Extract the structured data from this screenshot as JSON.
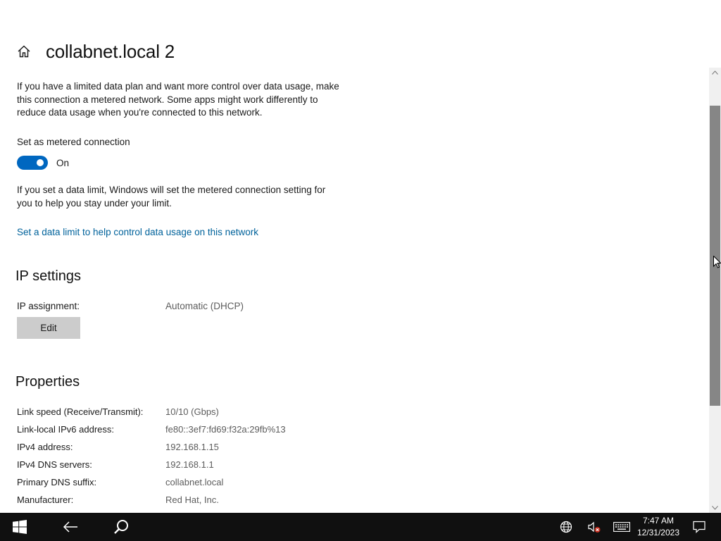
{
  "page": {
    "title": "collabnet.local 2",
    "metered_description": "If you have a limited data plan and want more control over data usage, make this connection a metered network. Some apps might work differently to reduce data usage when you're connected to this network.",
    "metered_label": "Set as metered connection",
    "metered_toggle_state": "On",
    "metered_toggle_on": true,
    "data_limit_note": "If you set a data limit, Windows will set the metered connection setting for you to help you stay under your limit.",
    "data_limit_link": "Set a data limit to help control data usage on this network"
  },
  "ip_settings": {
    "heading": "IP settings",
    "assignment_label": "IP assignment:",
    "assignment_value": "Automatic (DHCP)",
    "edit_label": "Edit"
  },
  "properties": {
    "heading": "Properties",
    "rows": [
      {
        "key": "Link speed (Receive/Transmit):",
        "value": "10/10 (Gbps)"
      },
      {
        "key": "Link-local IPv6 address:",
        "value": "fe80::3ef7:fd69:f32a:29fb%13"
      },
      {
        "key": "IPv4 address:",
        "value": "192.168.1.15"
      },
      {
        "key": "IPv4 DNS servers:",
        "value": "192.168.1.1"
      },
      {
        "key": "Primary DNS suffix:",
        "value": "collabnet.local"
      },
      {
        "key": "Manufacturer:",
        "value": "Red Hat, Inc."
      }
    ]
  },
  "taskbar": {
    "time": "7:47 AM",
    "date": "12/31/2023",
    "icons": [
      "windows-start-icon",
      "back-arrow-icon",
      "search-icon",
      "network-globe-icon",
      "volume-muted-icon",
      "keyboard-icon",
      "notification-icon"
    ]
  },
  "colors": {
    "accent": "#0067c0",
    "link": "#00629b",
    "taskbar": "#101010",
    "button": "#cccccc"
  }
}
